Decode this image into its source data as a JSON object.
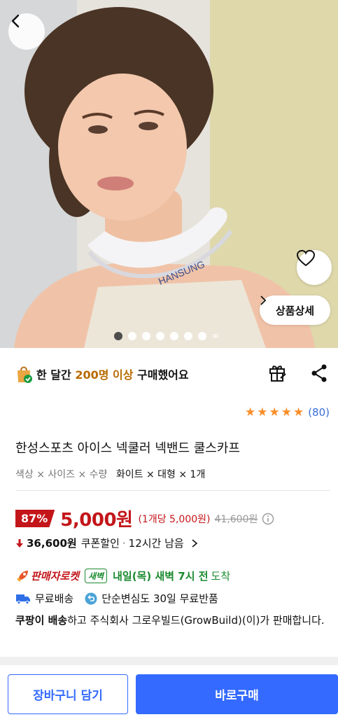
{
  "hero": {
    "brand_text": "HANSUNG",
    "detail_button_label": "상품상세",
    "carousel_pages": 7,
    "carousel_active": 0
  },
  "purchase_stat": {
    "prefix": "한 달간 ",
    "highlight": "200명 이상",
    "suffix": " 구매했어요"
  },
  "rating": {
    "stars": 5,
    "count_label": "(80)"
  },
  "product": {
    "title": "한성스포츠 아이스 넥쿨러 넥밴드 쿨스카프",
    "option_labels": "색상 × 사이즈 × 수량",
    "option_values": "화이트 × 대형 × 1개"
  },
  "price": {
    "discount_badge": "87%",
    "sale_price": "5,000원",
    "unit_price": "(1개당 5,000원)",
    "original_price": "41,600원"
  },
  "coupon": {
    "amount": "36,600원",
    "label": "쿠폰할인",
    "separator": "·",
    "time_left": "12시간 남음"
  },
  "delivery": {
    "rocket_label": "판매자로켓",
    "dawn_badge": "새벽",
    "arrival": "내일(목) 새벽 7시 전",
    "arrival_suffix": "도착",
    "free_shipping": "무료배송",
    "free_return": "단순변심도 30일 무료반품"
  },
  "seller": {
    "bold": "쿠팡이 배송",
    "text": "하고 주식회사 그로우빌드(GrowBuild)(이)가 판매합니다."
  },
  "bottom_bar": {
    "cart_label": "장바구니 담기",
    "buy_label": "바로구매"
  },
  "colors": {
    "accent_blue": "#346aff",
    "discount_red": "#c3161a",
    "dawn_green": "#1b8a2f",
    "star_orange": "#f98e2b",
    "highlight_brown": "#b86b00"
  },
  "icons": [
    "back-arrow-icon",
    "heart-icon",
    "chevron-right-icon",
    "shopping-bag-check-icon",
    "gift-icon",
    "share-icon",
    "star-icon",
    "info-icon",
    "down-arrow-icon",
    "rocket-icon",
    "truck-icon",
    "return-icon"
  ]
}
